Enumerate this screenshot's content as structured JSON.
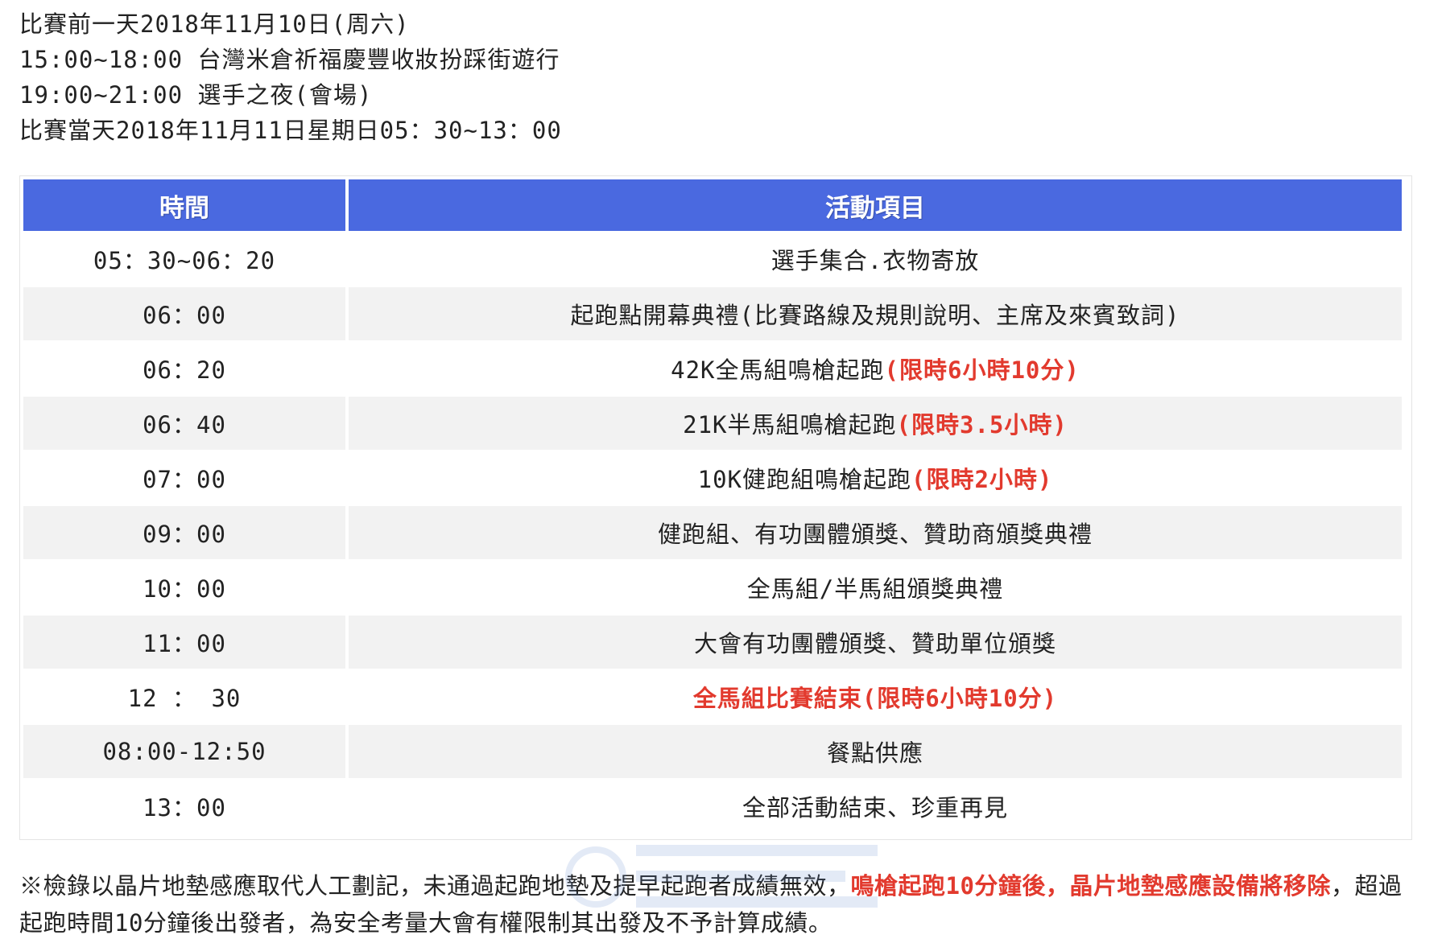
{
  "intro": {
    "lines": [
      "比賽前一天2018年11月10日(周六)",
      "15:00~18:00 台灣米倉祈福慶豐收妝扮踩街遊行",
      "19:00~21:00 選手之夜(會場)",
      "比賽當天2018年11月11日星期日05：30~13：00"
    ]
  },
  "table": {
    "headers": {
      "time": "時間",
      "activity": "活動項目"
    },
    "rows": [
      {
        "time": "05：30~06：20",
        "activity": "選手集合.衣物寄放",
        "note": ""
      },
      {
        "time": "06：00",
        "activity": "起跑點開幕典禮(比賽路線及規則說明、主席及來賓致詞)",
        "note": ""
      },
      {
        "time": "06：20",
        "activity": "42K全馬組鳴槍起跑",
        "note": "(限時6小時10分)"
      },
      {
        "time": "06：40",
        "activity": "21K半馬組鳴槍起跑",
        "note": "(限時3.5小時)"
      },
      {
        "time": "07：00",
        "activity": "10K健跑組鳴槍起跑",
        "note": "(限時2小時)"
      },
      {
        "time": "09：00",
        "activity": "健跑組、有功團體頒獎、贊助商頒獎典禮",
        "note": ""
      },
      {
        "time": "10：00",
        "activity": "全馬組/半馬組頒獎典禮",
        "note": ""
      },
      {
        "time": "11：00",
        "activity": "大會有功團體頒獎、贊助單位頒獎",
        "note": ""
      },
      {
        "time": "12 ： 30",
        "activity": "",
        "note": "全馬組比賽結束(限時6小時10分)"
      },
      {
        "time": "08:00-12:50",
        "activity": "餐點供應",
        "note": ""
      },
      {
        "time": "13：00",
        "activity": "全部活動結束、珍重再見",
        "note": ""
      }
    ]
  },
  "footnote": {
    "part1": "※檢錄以晶片地墊感應取代人工劃記，未通過起跑地墊及提早起跑者成績無效，",
    "part2_red": "鳴槍起跑10分鐘後，晶片地墊感應設備將移除",
    "part3": "，超過起跑時間10分鐘後出發者，為安全考量大會有權限制其出發及不予計算成績。"
  },
  "colors": {
    "header_bg": "#4a69e0",
    "accent_red": "#e23a2e",
    "row_alt": "#f2f2f2"
  }
}
